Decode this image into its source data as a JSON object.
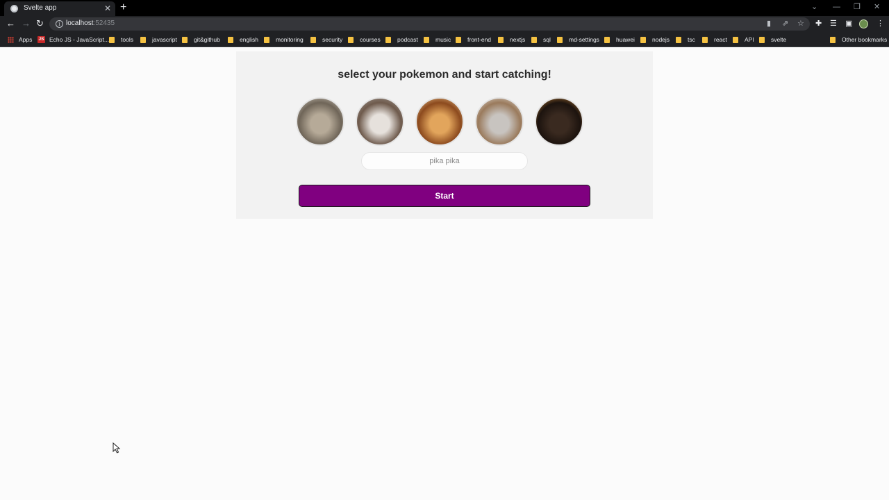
{
  "browser": {
    "tab": {
      "title": "Svelte app",
      "close_glyph": "✕"
    },
    "new_tab_glyph": "+",
    "window_controls": {
      "dropdown": "⌄",
      "minimize": "—",
      "restore": "❐",
      "close": "✕"
    },
    "nav": {
      "back": "←",
      "forward": "→",
      "reload": "↻"
    },
    "address": {
      "host": "localhost",
      "port": ":52435"
    },
    "bookmarks": [
      {
        "label": "Apps",
        "icon": "apps-icon"
      },
      {
        "label": "Echo JS - JavaScript...",
        "icon": "echojs-icon"
      },
      {
        "label": "tools",
        "icon": "folder-icon"
      },
      {
        "label": "javascript",
        "icon": "folder-icon"
      },
      {
        "label": "git&github",
        "icon": "folder-icon"
      },
      {
        "label": "english",
        "icon": "folder-icon"
      },
      {
        "label": "monitoring",
        "icon": "folder-icon"
      },
      {
        "label": "security",
        "icon": "folder-icon"
      },
      {
        "label": "courses",
        "icon": "folder-icon"
      },
      {
        "label": "podcast",
        "icon": "folder-icon"
      },
      {
        "label": "music",
        "icon": "folder-icon"
      },
      {
        "label": "front-end",
        "icon": "folder-icon"
      },
      {
        "label": "nextjs",
        "icon": "folder-icon"
      },
      {
        "label": "sql",
        "icon": "folder-icon"
      },
      {
        "label": "md-settings",
        "icon": "folder-icon"
      },
      {
        "label": "huawei",
        "icon": "folder-icon"
      },
      {
        "label": "nodejs",
        "icon": "folder-icon"
      },
      {
        "label": "tsc",
        "icon": "folder-icon"
      },
      {
        "label": "react",
        "icon": "folder-icon"
      },
      {
        "label": "API",
        "icon": "folder-icon"
      },
      {
        "label": "svelte",
        "icon": "folder-icon"
      },
      {
        "label": "Other bookmarks",
        "icon": "folder-icon"
      }
    ],
    "echojs_badge": "JS"
  },
  "app": {
    "heading": "select your pokemon and start catching!",
    "pokemon": [
      {
        "name": "cat-1",
        "colors": [
          "#b6aa98",
          "#6f6558",
          "#d9d2c6"
        ]
      },
      {
        "name": "cat-2",
        "colors": [
          "#e6e1dc",
          "#6e5a4c",
          "#a9a29b"
        ]
      },
      {
        "name": "cat-3",
        "colors": [
          "#e2a55c",
          "#8c4a1e",
          "#f3d29a"
        ]
      },
      {
        "name": "cat-4",
        "colors": [
          "#c8c4c0",
          "#9a7a5c",
          "#e8e4e0"
        ]
      },
      {
        "name": "cat-5",
        "colors": [
          "#3a2a20",
          "#1c130e",
          "#d9913c"
        ]
      }
    ],
    "name_input": {
      "placeholder": "pika pika",
      "value": ""
    },
    "start_button": "Start"
  },
  "colors": {
    "accent": "#800080"
  }
}
